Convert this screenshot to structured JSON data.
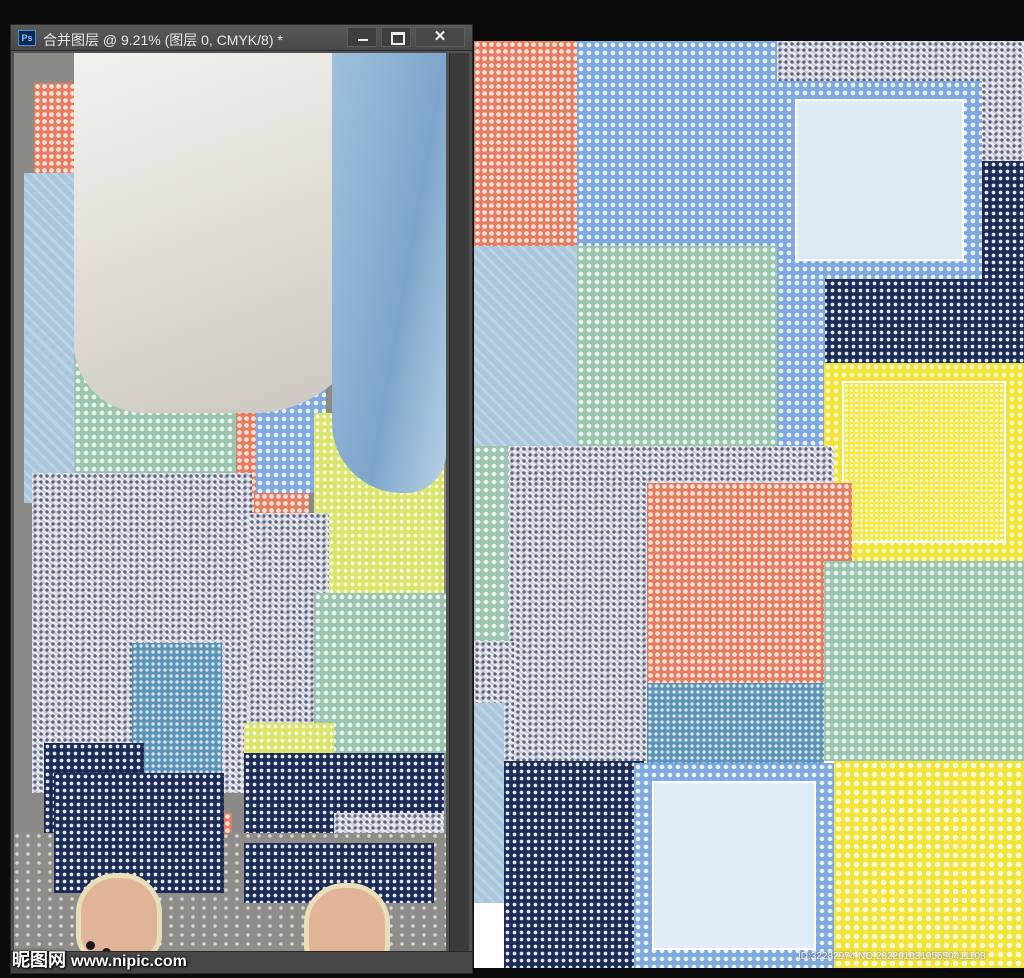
{
  "window": {
    "app_badge": "Ps",
    "title": "合并图层 @ 9.21% (图层 0, CMYK/8) *",
    "minimize_icon": "minimize-icon",
    "maximize_icon": "maximize-icon",
    "close_icon": "close-icon",
    "close_glyph": "✕"
  },
  "status": {
    "zoom": "9.21%"
  },
  "watermark": {
    "logo": "昵图网",
    "site": "www.nipic.com",
    "id_text": "ID:32282974 NO:20220103105550411108"
  },
  "colors": {
    "coral": "#e57d62",
    "sky_blue": "#7fa8de",
    "mint": "#9cc4ae",
    "navy": "#1c2a55",
    "yellow": "#f2e33a",
    "steel_blue": "#5d93b6"
  }
}
